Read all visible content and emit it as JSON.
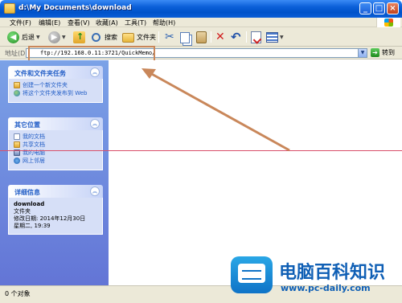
{
  "window": {
    "title": "d:\\My Documents\\download",
    "buttons": {
      "minimize": "_",
      "maximize": "□",
      "close": "×"
    }
  },
  "menu": [
    "文件(F)",
    "编辑(E)",
    "查看(V)",
    "收藏(A)",
    "工具(T)",
    "帮助(H)"
  ],
  "toolbar": {
    "back_label": "后退",
    "search_label": "搜索",
    "folders_label": "文件夹"
  },
  "address": {
    "label": "地址(D)",
    "value": "ftp://192.168.0.11:3721/QuickMemo/",
    "go_label": "转到"
  },
  "left_pane": {
    "tasks": {
      "title": "文件和文件夹任务",
      "items": [
        "创建一个新文件夹",
        "将这个文件夹发布到 Web"
      ]
    },
    "places": {
      "title": "其它位置",
      "items": [
        "我的文档",
        "共享文档",
        "我的电脑",
        "网上邻居"
      ]
    },
    "details": {
      "title": "详细信息",
      "name": "download",
      "type": "文件夹",
      "modified_label": "修改日期: 2014年12月30日",
      "modified_time": "星期二, 19:39"
    }
  },
  "status": {
    "text": "0 个对象"
  },
  "watermark": {
    "title": "电脑百科知识",
    "url": "www.pc-daily.com"
  },
  "colors": {
    "title_bar": "#0a5fd8",
    "left_pane": "#6f8cdd",
    "annotation": "#c9875a",
    "guide_line": "#d9506a",
    "watermark": "#0f5fb5"
  }
}
